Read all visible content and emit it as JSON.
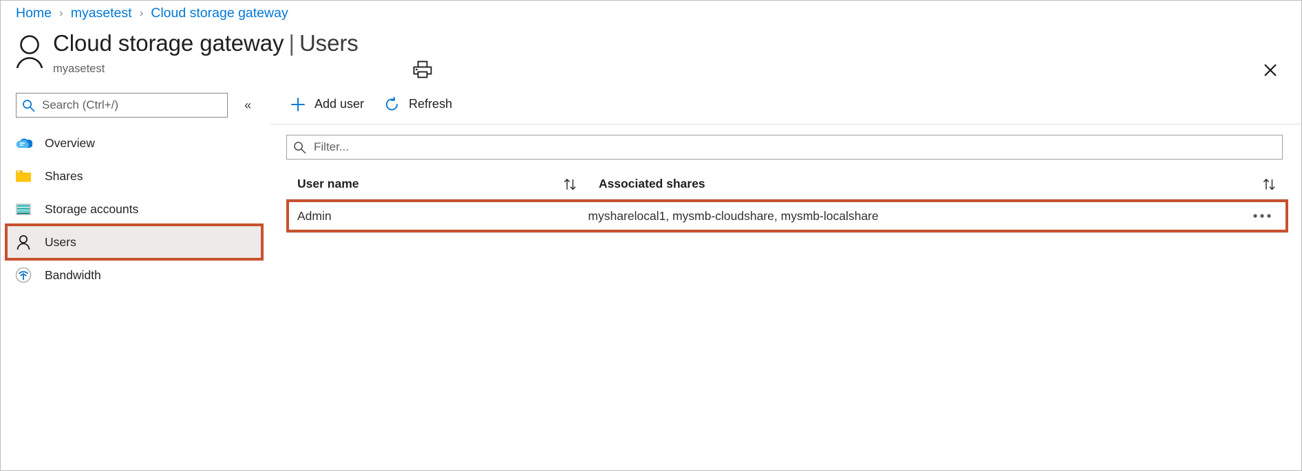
{
  "breadcrumb": {
    "items": [
      {
        "label": "Home"
      },
      {
        "label": "myasetest"
      },
      {
        "label": "Cloud storage gateway"
      }
    ],
    "separator": "›"
  },
  "header": {
    "avatar_icon": "person-icon",
    "title_main": "Cloud storage gateway",
    "title_separator": "|",
    "title_sub": "Users",
    "subtitle": "myasetest",
    "print_icon": "print-icon",
    "close_icon": "close-icon"
  },
  "sidebar": {
    "search": {
      "placeholder": "Search (Ctrl+/)",
      "value": "",
      "icon": "search-icon"
    },
    "collapse": {
      "icon": "chevron-double-left-icon",
      "glyph": "«"
    },
    "items": [
      {
        "label": "Overview",
        "icon": "cloud-icon",
        "selected": false
      },
      {
        "label": "Shares",
        "icon": "folder-icon",
        "selected": false
      },
      {
        "label": "Storage accounts",
        "icon": "storage-account-icon",
        "selected": false
      },
      {
        "label": "Users",
        "icon": "person-icon",
        "selected": true
      },
      {
        "label": "Bandwidth",
        "icon": "bandwidth-wifi-icon",
        "selected": false
      }
    ]
  },
  "main": {
    "toolbar": {
      "add_user_label": "Add user",
      "add_user_icon": "plus-icon",
      "refresh_label": "Refresh",
      "refresh_icon": "refresh-icon"
    },
    "filter": {
      "placeholder": "Filter...",
      "value": "",
      "icon": "search-icon"
    },
    "table": {
      "columns": [
        {
          "label": "User name",
          "sort_icon": "sort-updown-icon"
        },
        {
          "label": "Associated shares",
          "sort_icon": "sort-updown-icon"
        }
      ],
      "rows": [
        {
          "user_name": "Admin",
          "associated_shares": "mysharelocal1, mysmb-cloudshare, mysmb-localshare",
          "menu_icon": "ellipsis-icon",
          "highlighted": true
        }
      ]
    }
  },
  "colors": {
    "link": "#0078d4",
    "accent": "#0078d4",
    "highlight_border": "#c8512f",
    "selected_row_bg": "#edebe9",
    "text": "#201f1e",
    "muted_text": "#605e5c"
  }
}
